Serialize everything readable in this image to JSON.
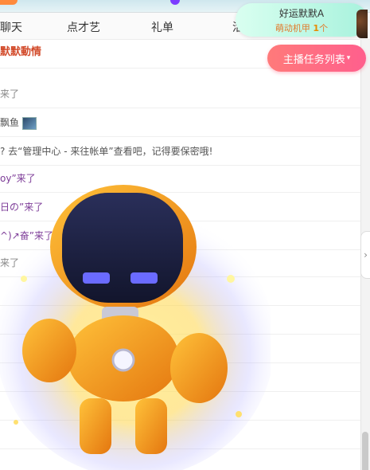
{
  "tabs": [
    "聊天",
    "点才艺",
    "礼单",
    "活"
  ],
  "notice": {
    "title": "好运默默A",
    "subtitle_prefix": "萌动机甲",
    "count": "1",
    "unit": "个"
  },
  "task_button": {
    "label": "主播任务列表",
    "icon": "chevron-down-icon"
  },
  "chat_rows": [
    {
      "text": "默默動情",
      "color": "#d24a2a"
    },
    {
      "text": "来了",
      "color": "#888888"
    },
    {
      "text": "飘鱼",
      "color": "#555555"
    },
    {
      "text": "? 去“管理中心 - 来往帐单”查看吧，记得要保密哦!",
      "color": "#555555"
    },
    {
      "text": "oy”来了",
      "color": "#7d3c98"
    },
    {
      "text": "日の”来了",
      "color": "#7d3c98"
    },
    {
      "text": "^)↗奋”来了",
      "color": "#7d3c98"
    },
    {
      "text": "来了",
      "color": "#888888"
    }
  ],
  "colors": {
    "accent": "#ff6b8a",
    "notice_bg": "#b5f3e2",
    "robot_orange": "#f59a1c",
    "robot_visor": "#1c2140",
    "robot_eyes": "#6b6bff"
  }
}
